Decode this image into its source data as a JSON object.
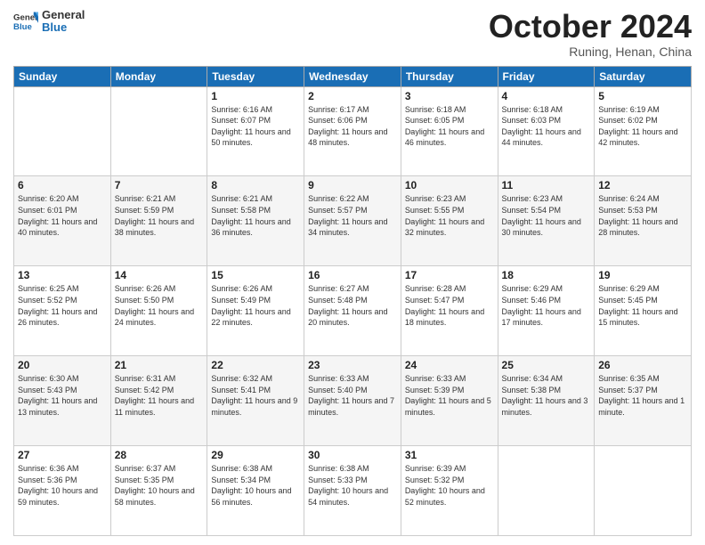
{
  "logo": {
    "line1": "General",
    "line2": "Blue"
  },
  "title": "October 2024",
  "subtitle": "Runing, Henan, China",
  "weekdays": [
    "Sunday",
    "Monday",
    "Tuesday",
    "Wednesday",
    "Thursday",
    "Friday",
    "Saturday"
  ],
  "weeks": [
    [
      {
        "day": "",
        "info": ""
      },
      {
        "day": "",
        "info": ""
      },
      {
        "day": "1",
        "info": "Sunrise: 6:16 AM\nSunset: 6:07 PM\nDaylight: 11 hours and 50 minutes."
      },
      {
        "day": "2",
        "info": "Sunrise: 6:17 AM\nSunset: 6:06 PM\nDaylight: 11 hours and 48 minutes."
      },
      {
        "day": "3",
        "info": "Sunrise: 6:18 AM\nSunset: 6:05 PM\nDaylight: 11 hours and 46 minutes."
      },
      {
        "day": "4",
        "info": "Sunrise: 6:18 AM\nSunset: 6:03 PM\nDaylight: 11 hours and 44 minutes."
      },
      {
        "day": "5",
        "info": "Sunrise: 6:19 AM\nSunset: 6:02 PM\nDaylight: 11 hours and 42 minutes."
      }
    ],
    [
      {
        "day": "6",
        "info": "Sunrise: 6:20 AM\nSunset: 6:01 PM\nDaylight: 11 hours and 40 minutes."
      },
      {
        "day": "7",
        "info": "Sunrise: 6:21 AM\nSunset: 5:59 PM\nDaylight: 11 hours and 38 minutes."
      },
      {
        "day": "8",
        "info": "Sunrise: 6:21 AM\nSunset: 5:58 PM\nDaylight: 11 hours and 36 minutes."
      },
      {
        "day": "9",
        "info": "Sunrise: 6:22 AM\nSunset: 5:57 PM\nDaylight: 11 hours and 34 minutes."
      },
      {
        "day": "10",
        "info": "Sunrise: 6:23 AM\nSunset: 5:55 PM\nDaylight: 11 hours and 32 minutes."
      },
      {
        "day": "11",
        "info": "Sunrise: 6:23 AM\nSunset: 5:54 PM\nDaylight: 11 hours and 30 minutes."
      },
      {
        "day": "12",
        "info": "Sunrise: 6:24 AM\nSunset: 5:53 PM\nDaylight: 11 hours and 28 minutes."
      }
    ],
    [
      {
        "day": "13",
        "info": "Sunrise: 6:25 AM\nSunset: 5:52 PM\nDaylight: 11 hours and 26 minutes."
      },
      {
        "day": "14",
        "info": "Sunrise: 6:26 AM\nSunset: 5:50 PM\nDaylight: 11 hours and 24 minutes."
      },
      {
        "day": "15",
        "info": "Sunrise: 6:26 AM\nSunset: 5:49 PM\nDaylight: 11 hours and 22 minutes."
      },
      {
        "day": "16",
        "info": "Sunrise: 6:27 AM\nSunset: 5:48 PM\nDaylight: 11 hours and 20 minutes."
      },
      {
        "day": "17",
        "info": "Sunrise: 6:28 AM\nSunset: 5:47 PM\nDaylight: 11 hours and 18 minutes."
      },
      {
        "day": "18",
        "info": "Sunrise: 6:29 AM\nSunset: 5:46 PM\nDaylight: 11 hours and 17 minutes."
      },
      {
        "day": "19",
        "info": "Sunrise: 6:29 AM\nSunset: 5:45 PM\nDaylight: 11 hours and 15 minutes."
      }
    ],
    [
      {
        "day": "20",
        "info": "Sunrise: 6:30 AM\nSunset: 5:43 PM\nDaylight: 11 hours and 13 minutes."
      },
      {
        "day": "21",
        "info": "Sunrise: 6:31 AM\nSunset: 5:42 PM\nDaylight: 11 hours and 11 minutes."
      },
      {
        "day": "22",
        "info": "Sunrise: 6:32 AM\nSunset: 5:41 PM\nDaylight: 11 hours and 9 minutes."
      },
      {
        "day": "23",
        "info": "Sunrise: 6:33 AM\nSunset: 5:40 PM\nDaylight: 11 hours and 7 minutes."
      },
      {
        "day": "24",
        "info": "Sunrise: 6:33 AM\nSunset: 5:39 PM\nDaylight: 11 hours and 5 minutes."
      },
      {
        "day": "25",
        "info": "Sunrise: 6:34 AM\nSunset: 5:38 PM\nDaylight: 11 hours and 3 minutes."
      },
      {
        "day": "26",
        "info": "Sunrise: 6:35 AM\nSunset: 5:37 PM\nDaylight: 11 hours and 1 minute."
      }
    ],
    [
      {
        "day": "27",
        "info": "Sunrise: 6:36 AM\nSunset: 5:36 PM\nDaylight: 10 hours and 59 minutes."
      },
      {
        "day": "28",
        "info": "Sunrise: 6:37 AM\nSunset: 5:35 PM\nDaylight: 10 hours and 58 minutes."
      },
      {
        "day": "29",
        "info": "Sunrise: 6:38 AM\nSunset: 5:34 PM\nDaylight: 10 hours and 56 minutes."
      },
      {
        "day": "30",
        "info": "Sunrise: 6:38 AM\nSunset: 5:33 PM\nDaylight: 10 hours and 54 minutes."
      },
      {
        "day": "31",
        "info": "Sunrise: 6:39 AM\nSunset: 5:32 PM\nDaylight: 10 hours and 52 minutes."
      },
      {
        "day": "",
        "info": ""
      },
      {
        "day": "",
        "info": ""
      }
    ]
  ]
}
